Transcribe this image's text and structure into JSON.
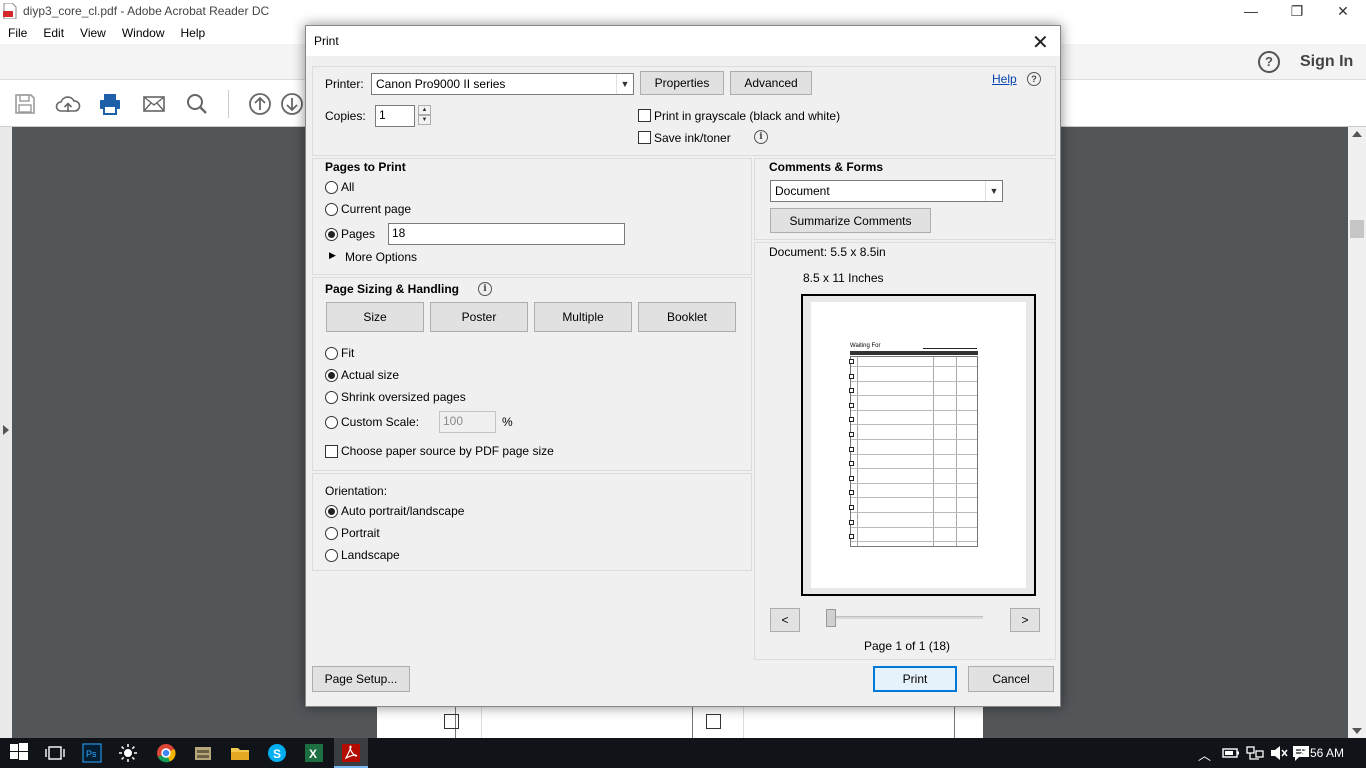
{
  "window": {
    "title": "diyp3_core_cl.pdf - Adobe Acrobat Reader DC",
    "minimize": "—",
    "restore": "❐",
    "close": "✕"
  },
  "menu": [
    "File",
    "Edit",
    "View",
    "Window",
    "Help"
  ],
  "header": {
    "help": "?",
    "sign_in": "Sign In"
  },
  "toolbar_icons": [
    "save-icon",
    "cloud-upload-icon",
    "print-icon",
    "email-icon",
    "search-icon",
    "page-up-icon",
    "page-down-icon"
  ],
  "dialog": {
    "title": "Print",
    "close": "✕",
    "printer_label": "Printer:",
    "printer_value": "Canon Pro9000 II series",
    "properties": "Properties",
    "advanced": "Advanced",
    "help_link": "Help",
    "copies_label": "Copies:",
    "copies_value": "1",
    "grayscale": "Print in grayscale (black and white)",
    "save_ink": "Save ink/toner",
    "pages_to_print": {
      "heading": "Pages to Print",
      "all": "All",
      "current": "Current page",
      "pages": "Pages",
      "pages_value": "18",
      "more": "More Options"
    },
    "sizing": {
      "heading": "Page Sizing & Handling",
      "tabs": [
        "Size",
        "Poster",
        "Multiple",
        "Booklet"
      ],
      "fit": "Fit",
      "actual": "Actual size",
      "shrink": "Shrink oversized pages",
      "custom": "Custom Scale:",
      "scale_placeholder": "100",
      "percent": "%",
      "paper_source": "Choose paper source by PDF page size"
    },
    "orientation": {
      "heading": "Orientation:",
      "auto": "Auto portrait/landscape",
      "portrait": "Portrait",
      "landscape": "Landscape"
    },
    "comments": {
      "heading": "Comments & Forms",
      "value": "Document",
      "summarize": "Summarize Comments"
    },
    "preview": {
      "document_size": "Document: 5.5 x 8.5in",
      "paper_size": "8.5 x 11 Inches",
      "page_title": "Waiting For",
      "prev": "<",
      "next": ">",
      "page_info": "Page 1 of 1 (18)"
    },
    "page_setup": "Page Setup...",
    "print": "Print",
    "cancel": "Cancel"
  },
  "taskbar": {
    "time": "8:56 AM"
  },
  "colors": {
    "accent": "#0078d7",
    "acrobat_red": "#cc0000",
    "taskbar": "#101418"
  }
}
